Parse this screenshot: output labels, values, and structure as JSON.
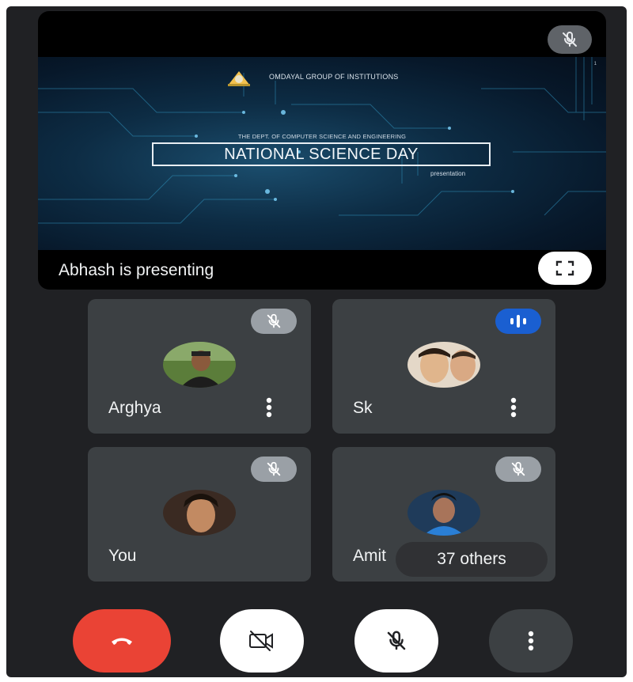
{
  "presentation": {
    "org_name": "OMDAYAL GROUP OF INSTITUTIONS",
    "dept": "THE DEPT. OF COMPUTER SCIENCE AND ENGINEERING",
    "title": "NATIONAL SCIENCE DAY",
    "subtitle": "presentation",
    "slide_number": "1",
    "presenting_text": "Abhash is presenting",
    "mic_icon": "mic-off-icon",
    "fullscreen_icon": "fullscreen-icon"
  },
  "participants": [
    {
      "name": "Arghya",
      "mic": "muted"
    },
    {
      "name": "Sk",
      "mic": "speaking"
    },
    {
      "name": "You",
      "mic": "muted"
    },
    {
      "name": "Amit",
      "mic": "muted",
      "overlay": "37 others"
    }
  ],
  "controls": [
    {
      "id": "end-call",
      "icon": "phone-hangup-icon",
      "color": "#ea4335"
    },
    {
      "id": "camera",
      "icon": "camera-off-icon",
      "color": "#ffffff"
    },
    {
      "id": "mic",
      "icon": "mic-off-icon",
      "color": "#ffffff"
    },
    {
      "id": "more",
      "icon": "more-vertical-icon",
      "color": "#3c4043"
    }
  ],
  "colors": {
    "background": "#202124",
    "tile": "#3c4043",
    "speaking": "#1a5fd1",
    "end_call": "#ea4335"
  }
}
